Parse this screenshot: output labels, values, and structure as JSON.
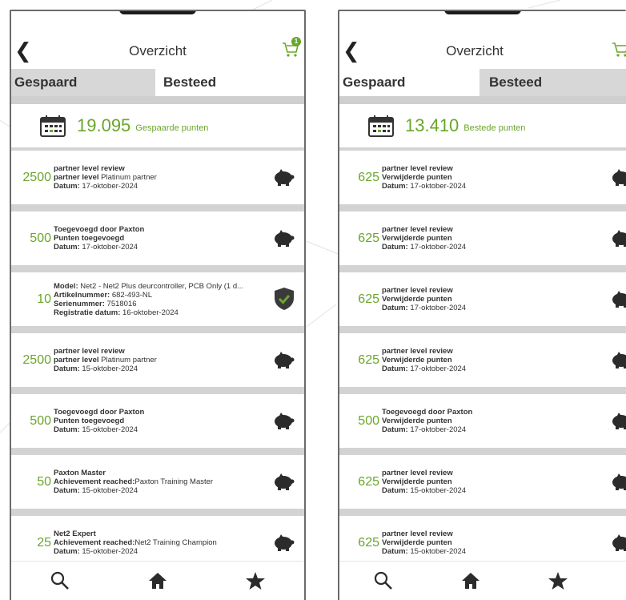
{
  "left": {
    "title": "Overzicht",
    "cart_badge": "1",
    "tabs": [
      "Gespaard",
      "Besteed"
    ],
    "summary": {
      "value": "19.095",
      "label": "Gespaarde punten"
    },
    "items": [
      {
        "points": "2500",
        "icon": "piggy-bank-icon",
        "lines": [
          {
            "bold": "partner level review",
            "text": ""
          },
          {
            "bold": "partner level",
            "text": " Platinum partner"
          },
          {
            "bold": "Datum:",
            "text": " 17-oktober-2024"
          }
        ]
      },
      {
        "points": "500",
        "icon": "piggy-bank-icon",
        "lines": [
          {
            "bold": "Toegevoegd door Paxton",
            "text": ""
          },
          {
            "bold": "Punten toegevoegd",
            "text": ""
          },
          {
            "bold": "Datum:",
            "text": " 17-oktober-2024"
          }
        ]
      },
      {
        "points": "10",
        "icon": "shield-check-icon",
        "lines": [
          {
            "bold": "Model:",
            "text": " Net2 - Net2 Plus deurcontroller, PCB Only (1 d..."
          },
          {
            "bold": "Artikelnummer:",
            "text": " 682-493-NL"
          },
          {
            "bold": "Serienummer:",
            "text": " 7518016"
          },
          {
            "bold": "Registratie datum:",
            "text": " 16-oktober-2024"
          }
        ]
      },
      {
        "points": "2500",
        "icon": "piggy-bank-icon",
        "lines": [
          {
            "bold": "partner level review",
            "text": ""
          },
          {
            "bold": "partner level",
            "text": " Platinum partner"
          },
          {
            "bold": "Datum:",
            "text": " 15-oktober-2024"
          }
        ]
      },
      {
        "points": "500",
        "icon": "piggy-bank-icon",
        "lines": [
          {
            "bold": "Toegevoegd door Paxton",
            "text": ""
          },
          {
            "bold": "Punten toegevoegd",
            "text": ""
          },
          {
            "bold": "Datum:",
            "text": " 15-oktober-2024"
          }
        ]
      },
      {
        "points": "50",
        "icon": "piggy-bank-icon",
        "lines": [
          {
            "bold": "Paxton Master",
            "text": ""
          },
          {
            "bold": "Achievement reached:",
            "text": "Paxton Training Master"
          },
          {
            "bold": "Datum:",
            "text": " 15-oktober-2024"
          }
        ]
      },
      {
        "points": "25",
        "icon": "piggy-bank-icon",
        "lines": [
          {
            "bold": "Net2 Expert",
            "text": ""
          },
          {
            "bold": "Achievement reached:",
            "text": "Net2 Training Champion"
          },
          {
            "bold": "Datum:",
            "text": " 15-oktober-2024"
          }
        ]
      }
    ]
  },
  "right": {
    "title": "Overzicht",
    "tabs": [
      "Gespaard",
      "Besteed"
    ],
    "summary": {
      "value": "13.410",
      "label": "Bestede punten"
    },
    "items": [
      {
        "points": "625",
        "icon": "piggy-bank-icon",
        "lines": [
          {
            "bold": "partner level review",
            "text": ""
          },
          {
            "bold": "Verwijderde punten",
            "text": ""
          },
          {
            "bold": "Datum:",
            "text": " 17-oktober-2024"
          }
        ]
      },
      {
        "points": "625",
        "icon": "piggy-bank-icon",
        "lines": [
          {
            "bold": "partner level review",
            "text": ""
          },
          {
            "bold": "Verwijderde punten",
            "text": ""
          },
          {
            "bold": "Datum:",
            "text": " 17-oktober-2024"
          }
        ]
      },
      {
        "points": "625",
        "icon": "piggy-bank-icon",
        "lines": [
          {
            "bold": "partner level review",
            "text": ""
          },
          {
            "bold": "Verwijderde punten",
            "text": ""
          },
          {
            "bold": "Datum:",
            "text": " 17-oktober-2024"
          }
        ]
      },
      {
        "points": "625",
        "icon": "piggy-bank-icon",
        "lines": [
          {
            "bold": "partner level review",
            "text": ""
          },
          {
            "bold": "Verwijderde punten",
            "text": ""
          },
          {
            "bold": "Datum:",
            "text": " 17-oktober-2024"
          }
        ]
      },
      {
        "points": "500",
        "icon": "piggy-bank-icon",
        "lines": [
          {
            "bold": "Toegevoegd door Paxton",
            "text": ""
          },
          {
            "bold": "Verwijderde punten",
            "text": ""
          },
          {
            "bold": "Datum:",
            "text": " 17-oktober-2024"
          }
        ]
      },
      {
        "points": "625",
        "icon": "piggy-bank-icon",
        "lines": [
          {
            "bold": "partner level review",
            "text": ""
          },
          {
            "bold": "Verwijderde punten",
            "text": ""
          },
          {
            "bold": "Datum:",
            "text": " 15-oktober-2024"
          }
        ]
      },
      {
        "points": "625",
        "icon": "piggy-bank-icon",
        "lines": [
          {
            "bold": "partner level review",
            "text": ""
          },
          {
            "bold": "Verwijderde punten",
            "text": ""
          },
          {
            "bold": "Datum:",
            "text": " 15-oktober-2024"
          }
        ]
      }
    ]
  },
  "tabbar": [
    "search-icon",
    "home-icon",
    "star-icon"
  ],
  "colors": {
    "accent": "#6aa62a",
    "separator": "#d3d3d3",
    "tab_inactive": "#d7d7d7",
    "icon": "#2b2b2b"
  }
}
